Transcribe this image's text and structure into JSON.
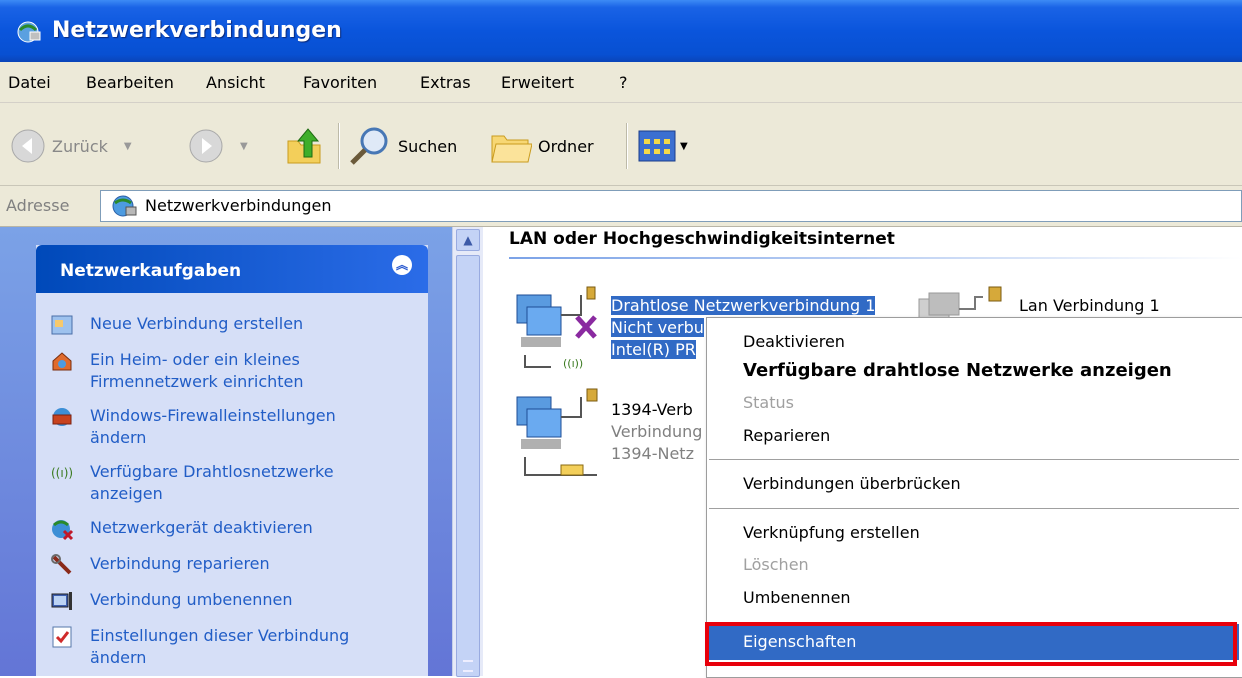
{
  "window": {
    "title": "Netzwerkverbindungen"
  },
  "menu": [
    "Datei",
    "Bearbeiten",
    "Ansicht",
    "Favoriten",
    "Extras",
    "Erweitert",
    "?"
  ],
  "toolbar": {
    "back": "Zurück",
    "search": "Suchen",
    "folders": "Ordner"
  },
  "address": {
    "label": "Adresse",
    "value": "Netzwerkverbindungen"
  },
  "tasks": {
    "title": "Netzwerkaufgaben",
    "items": [
      {
        "line1": "Neue Verbindung erstellen",
        "line2": ""
      },
      {
        "line1": "Ein Heim- oder ein kleines",
        "line2": "Firmennetzwerk einrichten"
      },
      {
        "line1": "Windows-Firewalleinstellungen",
        "line2": "ändern"
      },
      {
        "line1": "Verfügbare Drahtlosnetzwerke",
        "line2": "anzeigen"
      },
      {
        "line1": "Netzwerkgerät deaktivieren",
        "line2": ""
      },
      {
        "line1": "Verbindung reparieren",
        "line2": ""
      },
      {
        "line1": "Verbindung umbenennen",
        "line2": ""
      },
      {
        "line1": "Einstellungen dieser Verbindung",
        "line2": "ändern"
      }
    ]
  },
  "content": {
    "group": "LAN oder Hochgeschwindigkeitsinternet",
    "connections": [
      {
        "name": "Drahtlose Netzwerkverbindung 1",
        "status": "Nicht verbu",
        "device": "Intel(R) PR"
      },
      {
        "name": "Lan Verbindung 1"
      },
      {
        "name": "1394-Verb",
        "status": "Verbindung",
        "device": "1394-Netz"
      }
    ]
  },
  "context_menu": {
    "items": [
      "Deaktivieren",
      "Verfügbare drahtlose Netzwerke anzeigen",
      "Status",
      "Reparieren",
      "Verbindungen überbrücken",
      "Verknüpfung erstellen",
      "Löschen",
      "Umbenennen",
      "Eigenschaften"
    ],
    "highlighted": "Eigenschaften"
  },
  "colors": {
    "title_bar": "#0a55dc",
    "selection": "#316ac5",
    "task_link": "#215dc6",
    "annotation": "#e8000b"
  }
}
